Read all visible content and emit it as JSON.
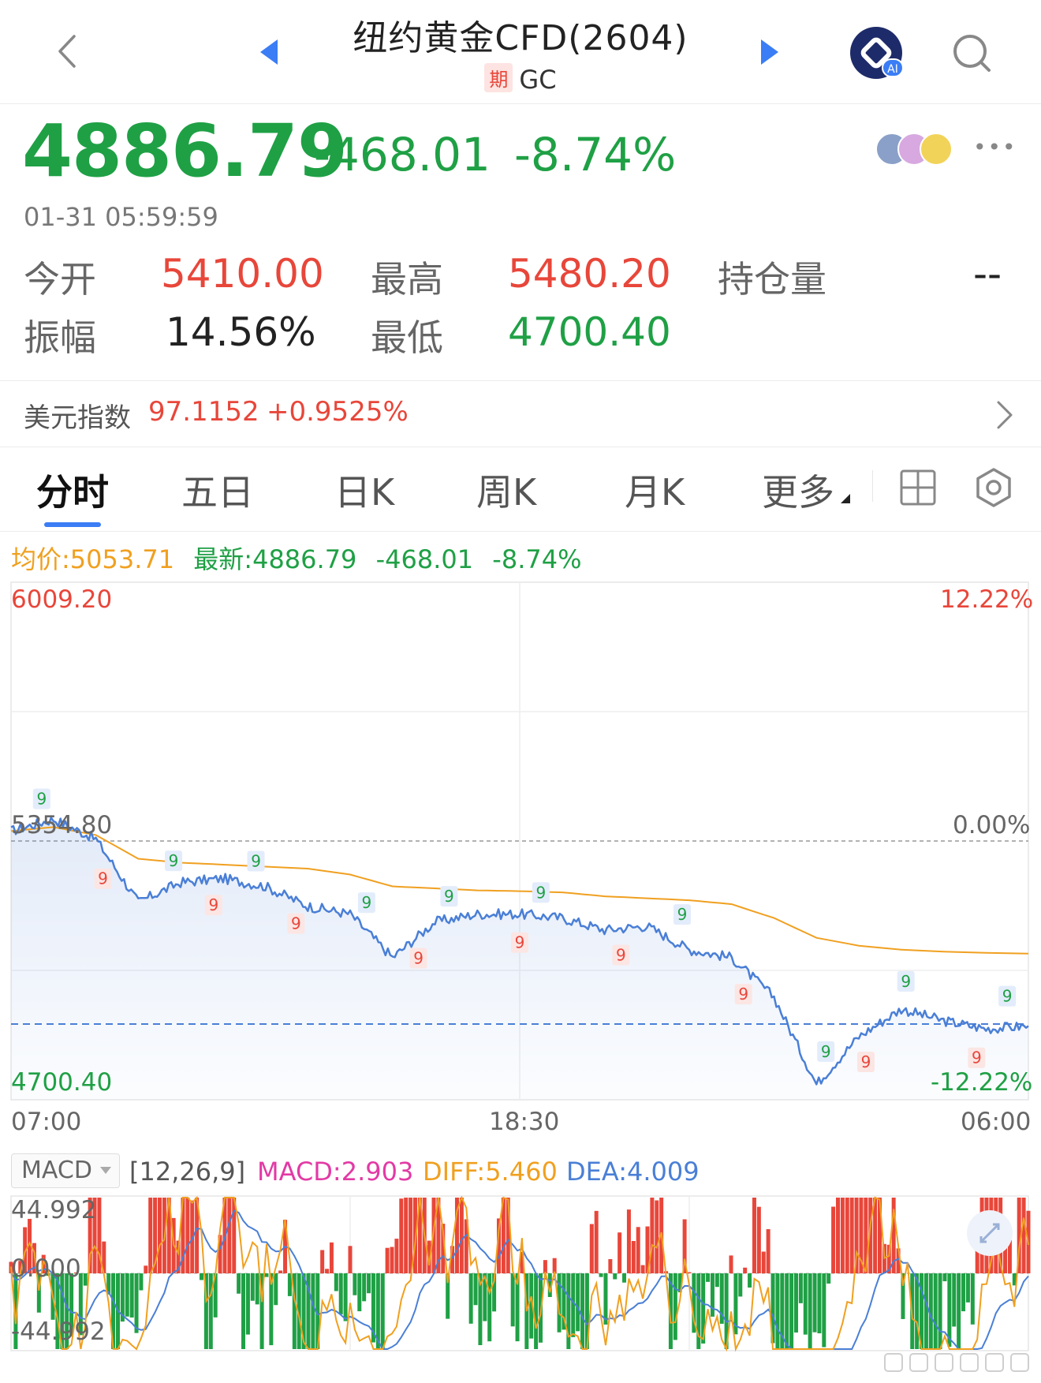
{
  "header": {
    "title": "纽约黄金CFD(2604)",
    "badge": "期",
    "code": "GC"
  },
  "quote": {
    "price": "4886.79",
    "change": "-468.01",
    "change_pct": "-8.74%",
    "timestamp": "01-31 05:59:59"
  },
  "stats": {
    "open_label": "今开",
    "open_value": "5410.00",
    "high_label": "最高",
    "high_value": "5480.20",
    "oi_label": "持仓量",
    "oi_value": "--",
    "amplitude_label": "振幅",
    "amplitude_value": "14.56%",
    "low_label": "最低",
    "low_value": "4700.40"
  },
  "usd_index": {
    "label": "美元指数",
    "value": "97.1152",
    "change": "+0.9525%"
  },
  "tabs": [
    "分时",
    "五日",
    "日K",
    "周K",
    "月K",
    "更多"
  ],
  "legend": {
    "avg": "均价:5053.71",
    "latest": "最新:4886.79",
    "change": "-468.01",
    "change_pct": "-8.74%"
  },
  "chart": {
    "y_top": "6009.20",
    "y_mid": "5354.80",
    "y_bottom": "4700.40",
    "pct_top": "12.22%",
    "pct_mid": "0.00%",
    "pct_bottom": "-12.22%",
    "x_start": "07:00",
    "x_mid": "18:30",
    "x_end": "06:00"
  },
  "chart_data": {
    "type": "line",
    "y_range": [
      4700.4,
      6009.2
    ],
    "prev_close": 5354.8,
    "latest": 4886.79,
    "series": [
      {
        "name": "最新",
        "x": [
          "07:00",
          "08:00",
          "09:00",
          "10:00",
          "11:00",
          "12:00",
          "13:00",
          "14:00",
          "15:00",
          "16:00",
          "17:00",
          "18:00",
          "18:30",
          "19:00",
          "20:00",
          "21:00",
          "22:00",
          "23:00",
          "00:00",
          "01:00",
          "02:00",
          "03:00",
          "04:00",
          "05:00",
          "06:00"
        ],
        "values": [
          5380,
          5410,
          5360,
          5200,
          5250,
          5260,
          5240,
          5190,
          5170,
          5060,
          5150,
          5170,
          5170,
          5160,
          5130,
          5140,
          5080,
          5060,
          4960,
          4740,
          4860,
          4930,
          4900,
          4880,
          4887
        ]
      },
      {
        "name": "均价",
        "x": [
          "07:00",
          "08:00",
          "09:00",
          "10:00",
          "11:00",
          "12:00",
          "13:00",
          "14:00",
          "15:00",
          "16:00",
          "17:00",
          "18:00",
          "18:30",
          "19:00",
          "20:00",
          "21:00",
          "22:00",
          "23:00",
          "00:00",
          "01:00",
          "02:00",
          "03:00",
          "04:00",
          "05:00",
          "06:00"
        ],
        "values": [
          5380,
          5390,
          5370,
          5310,
          5300,
          5295,
          5290,
          5285,
          5270,
          5240,
          5235,
          5230,
          5228,
          5225,
          5215,
          5210,
          5205,
          5195,
          5160,
          5110,
          5090,
          5080,
          5075,
          5072,
          5070
        ]
      }
    ]
  },
  "macd": {
    "selector": "MACD",
    "params": "[12,26,9]",
    "macd": "MACD:2.903",
    "diff": "DIFF:5.460",
    "dea": "DEA:4.009",
    "y_top": "44.992",
    "y_mid": "0.000",
    "y_bottom": "-44.992"
  },
  "colors": {
    "up": "#e8463a",
    "down": "#1fa045",
    "accent": "#3b7df5",
    "price_line": "#4a7fd6",
    "avg_line": "#f0a020"
  }
}
